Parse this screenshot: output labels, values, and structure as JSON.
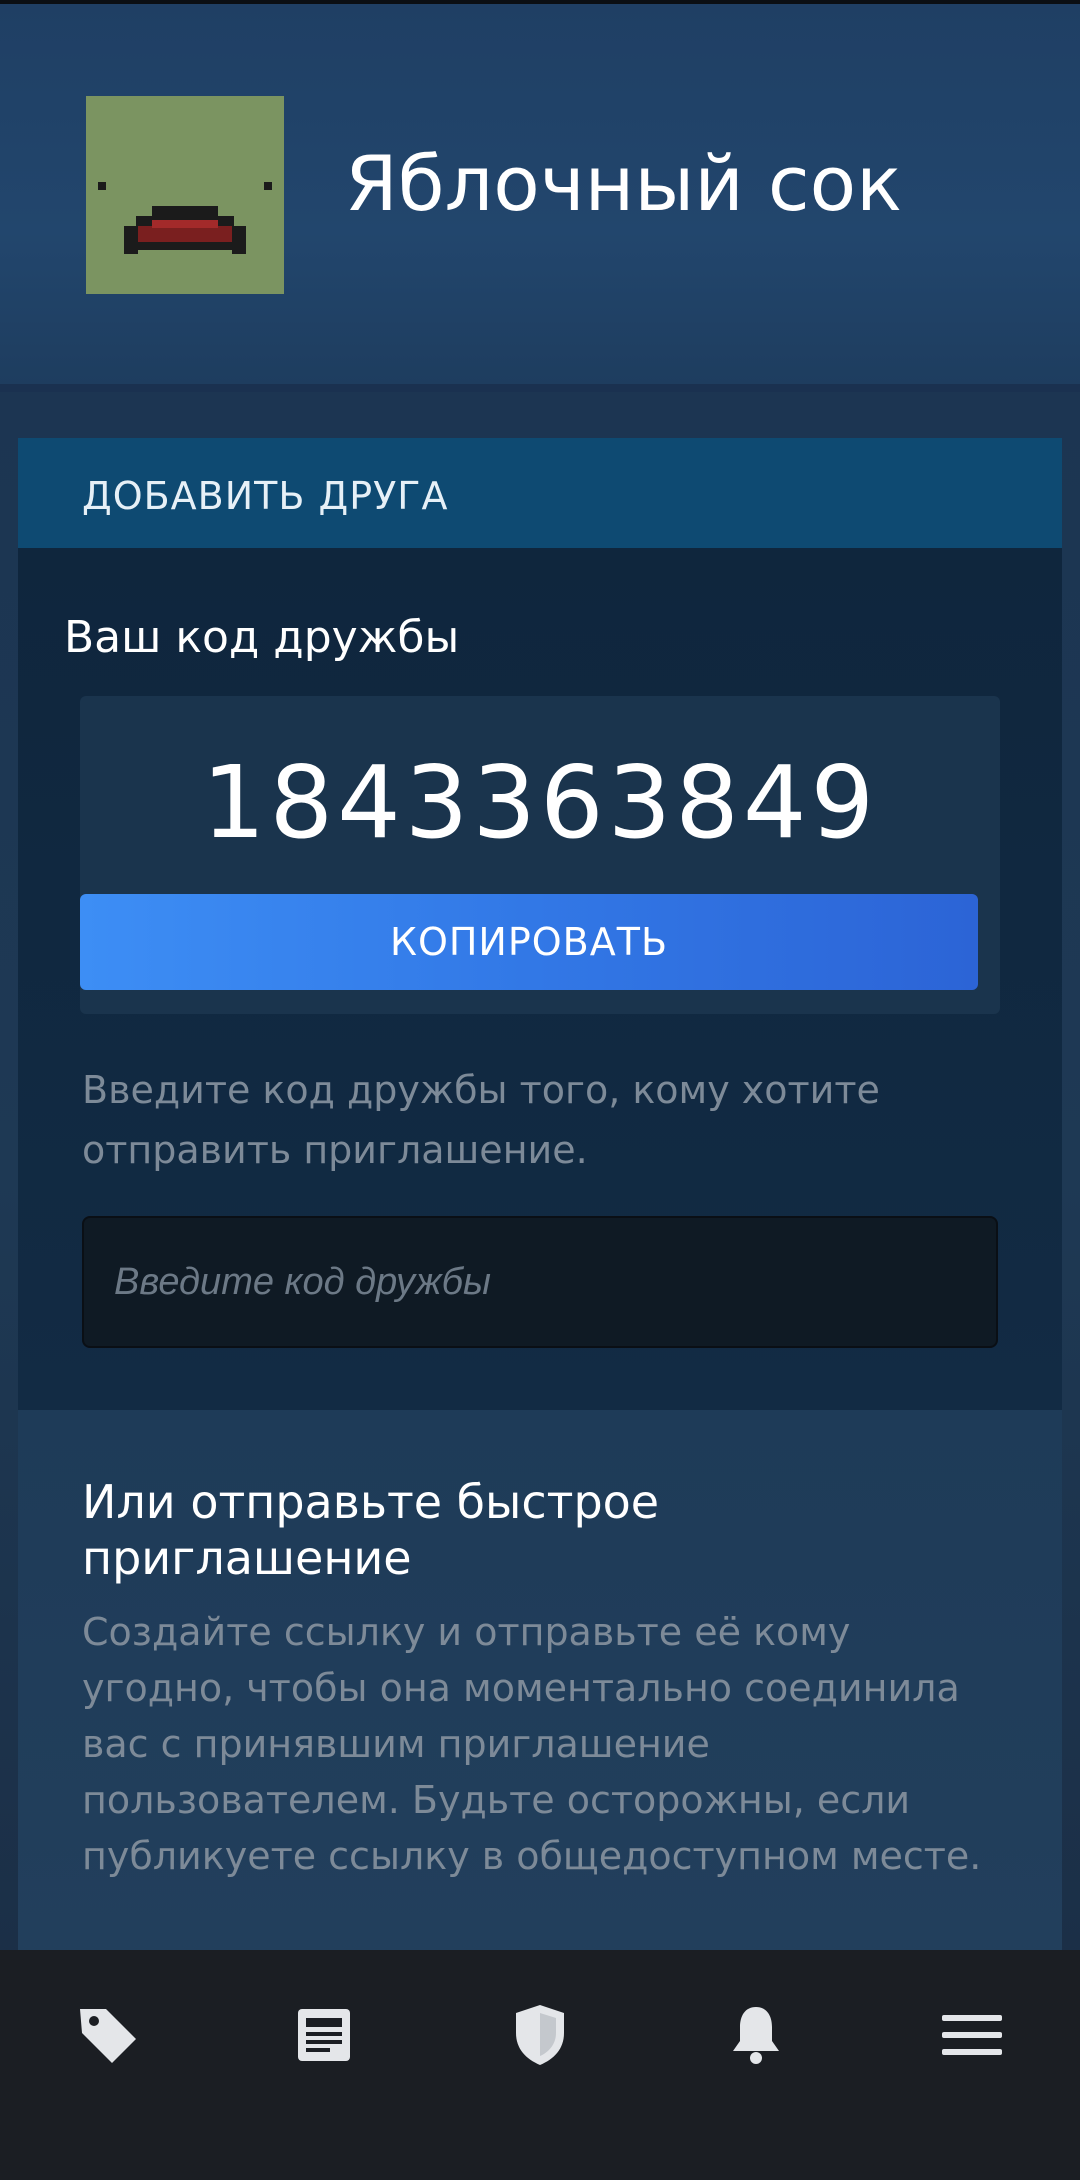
{
  "profile": {
    "username": "Яблочный сок"
  },
  "add_friend": {
    "panel_title": "ДОБАВИТЬ ДРУГА",
    "code_label": "Ваш код дружбы",
    "friend_code": "1843363849",
    "copy_label": "КОПИРОВАТЬ",
    "invite_description": "Введите код дружбы того, кому хотите отправить приглашение.",
    "input_placeholder": "Введите код дружбы",
    "input_value": ""
  },
  "quick_invite": {
    "title": "Или отправьте быстрое приглашение",
    "description": "Создайте ссылку и отправьте её кому угодно, чтобы она моментально соединила вас с принявшим приглашение пользователем. Будьте осторожны, если публикуете ссылку в общедоступном месте."
  },
  "bottom_nav": {
    "items": [
      {
        "icon": "tag-icon"
      },
      {
        "icon": "news-icon"
      },
      {
        "icon": "shield-icon"
      },
      {
        "icon": "bell-icon"
      },
      {
        "icon": "menu-icon"
      }
    ]
  },
  "colors": {
    "accent_blue": "#3d8ef5",
    "panel_header": "#0e4a72",
    "avatar_bg": "#7b9461"
  }
}
